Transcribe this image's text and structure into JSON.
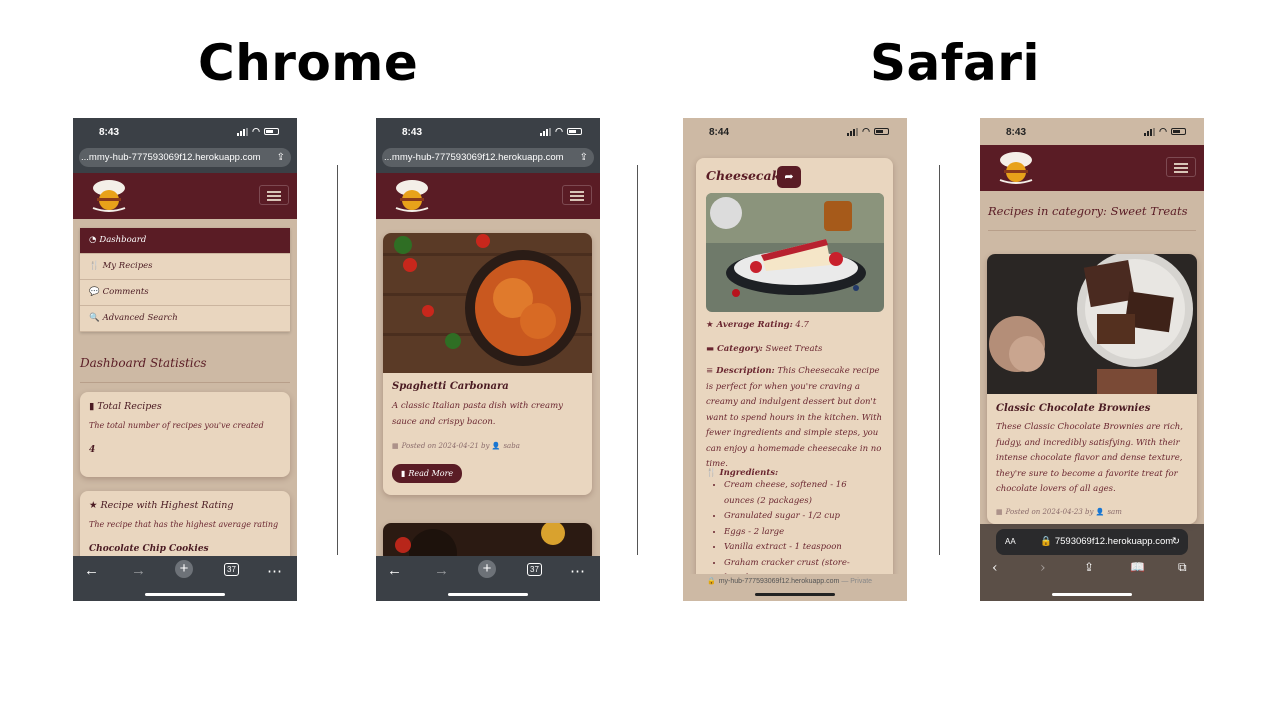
{
  "headings": {
    "left": "Chrome",
    "right": "Safari"
  },
  "colors": {
    "maroon": "#5a1c25",
    "card": "#e9d6bf",
    "background": "#cdb9a4"
  },
  "phones": {
    "p1": {
      "time": "8:43",
      "url": "...mmy-hub-777593069f12.herokuapp.com",
      "menu": [
        "Dashboard",
        "My Recipes",
        "Comments",
        "Advanced Search"
      ],
      "section_title": "Dashboard Statistics",
      "stat1": {
        "title": "Total Recipes",
        "desc": "The total number of recipes you've created",
        "value": "4"
      },
      "stat2": {
        "title": "Recipe with Highest Rating",
        "desc": "The recipe that has the highest average rating",
        "value": "Chocolate Chip Cookies"
      },
      "tab_count": "37"
    },
    "p2": {
      "time": "8:43",
      "url": "...mmy-hub-777593069f12.herokuapp.com",
      "recipe_title": "Spaghetti Carbonara",
      "recipe_desc": "A classic Italian pasta dish with creamy sauce and crispy bacon.",
      "posted_prefix": "Posted on 2024-04-21 by",
      "author": "saba",
      "button": "Read More",
      "tab_count": "37"
    },
    "p3": {
      "time": "8:44",
      "title": "Cheesecake",
      "rating_label": "Average Rating:",
      "rating": "4.7",
      "category_label": "Category:",
      "category": "Sweet Treats",
      "description_label": "Description:",
      "description": "This Cheesecake recipe is perfect for when you're craving a creamy and indulgent dessert but don't want to spend hours in the kitchen. With fewer ingredients and simple steps, you can enjoy a homemade cheesecake in no time.",
      "ingredients_label": "Ingredients:",
      "ingredients": [
        "Cream cheese, softened - 16 ounces (2 packages)",
        "Granulated sugar - 1/2 cup",
        "Eggs - 2 large",
        "Vanilla extract - 1 teaspoon",
        "Graham cracker crust (store-bought or"
      ],
      "footer_url": "my-hub-777593069f12.herokuapp.com",
      "footer_private": "— Private"
    },
    "p4": {
      "time": "8:43",
      "category_heading": "Recipes in category: Sweet Treats",
      "recipe_title": "Classic Chocolate Brownies",
      "recipe_desc": "These Classic Chocolate Brownies are rich, fudgy, and incredibly satisfying. With their intense chocolate flavor and dense texture, they're sure to become a favorite treat for chocolate lovers of all ages.",
      "posted_prefix": "Posted on 2024-04-23 by",
      "author": "sam",
      "address_aa": "AA",
      "address": "7593069f12.herokuapp.com"
    }
  }
}
